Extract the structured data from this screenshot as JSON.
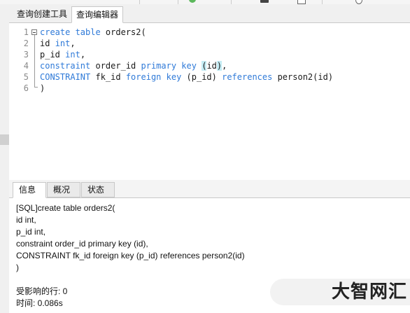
{
  "editor_tabs": [
    "查询创建工具",
    "查询编辑器"
  ],
  "active_editor_tab": "查询编辑器",
  "editor": {
    "line_numbers": [
      "1",
      "2",
      "3",
      "4",
      "5",
      "6"
    ],
    "lines": [
      [
        {
          "t": "create table",
          "k": true
        },
        {
          "t": " orders2(",
          "k": false
        }
      ],
      [
        {
          "t": "id ",
          "k": false
        },
        {
          "t": "int",
          "k": true
        },
        {
          "t": ",",
          "k": false
        }
      ],
      [
        {
          "t": "p_id ",
          "k": false
        },
        {
          "t": "int",
          "k": true
        },
        {
          "t": ",",
          "k": false
        }
      ],
      [
        {
          "t": "constraint",
          "k": true
        },
        {
          "t": " order_id ",
          "k": false
        },
        {
          "t": "primary key",
          "k": true
        },
        {
          "t": " ",
          "k": false
        },
        {
          "t": "(",
          "k": false,
          "hl": true
        },
        {
          "t": "id",
          "k": false
        },
        {
          "t": ")",
          "k": false,
          "hl": true
        },
        {
          "t": ",",
          "k": false
        }
      ],
      [
        {
          "t": "CONSTRAINT",
          "k": true
        },
        {
          "t": " fk_id ",
          "k": false
        },
        {
          "t": "foreign key",
          "k": true
        },
        {
          "t": " (p_id) ",
          "k": false
        },
        {
          "t": "references",
          "k": true
        },
        {
          "t": " person2(id)",
          "k": false
        }
      ],
      [
        {
          "t": ")",
          "k": false
        }
      ]
    ]
  },
  "result_tabs": [
    "信息",
    "概况",
    "状态"
  ],
  "active_result_tab": "信息",
  "messages": [
    "[SQL]create table orders2(",
    "id int,",
    "p_id int,",
    "constraint order_id primary key (id),",
    "CONSTRAINT fk_id foreign key (p_id) references person2(id)",
    ")",
    "",
    "受影响的行: 0",
    "时间: 0.086s"
  ],
  "watermark": "大智网汇",
  "colors": {
    "keyword": "#2f7ad8",
    "paren_highlight": "#c4ecf4",
    "line_number": "#8a8a8a"
  },
  "icons": [
    "fold-toggle-icon",
    "run-icon"
  ]
}
